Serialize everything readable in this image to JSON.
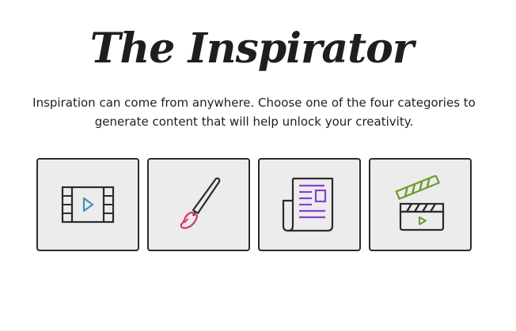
{
  "header": {
    "title": "The Inspirator",
    "subtitle": "Inspiration can come from anywhere. Choose one of the four categories to generate content that will help unlock your creativity."
  },
  "categories": [
    {
      "icon": "film-strip-icon",
      "accent_color": "#4a8db5"
    },
    {
      "icon": "paintbrush-icon",
      "accent_color": "#d6336c"
    },
    {
      "icon": "newspaper-icon",
      "accent_color": "#8a3fd1"
    },
    {
      "icon": "clapperboard-icon",
      "accent_color": "#6d9a2e"
    }
  ],
  "colors": {
    "card_background": "#ececec",
    "card_border": "#2b2b2b",
    "text": "#1e1e1e"
  }
}
